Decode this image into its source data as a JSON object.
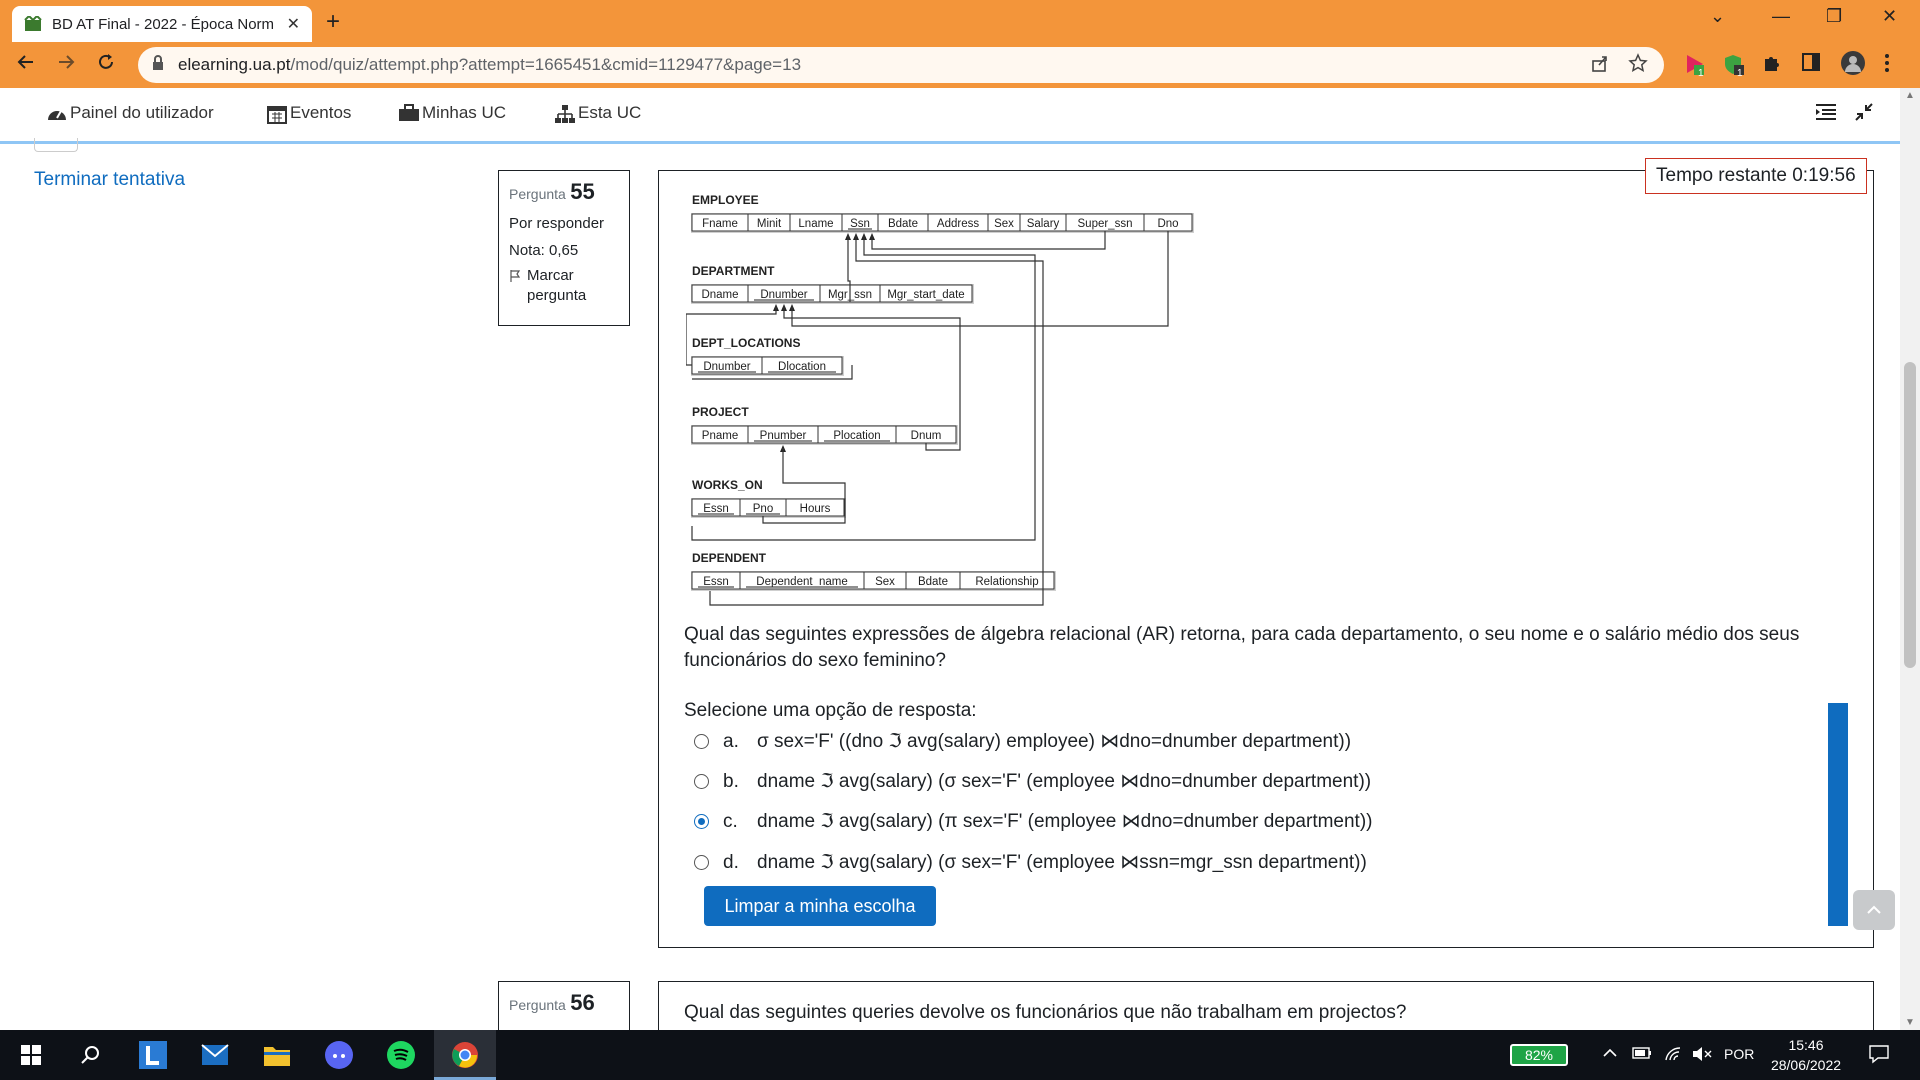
{
  "browser": {
    "tab_title": "BD AT Final - 2022 - Época Norm",
    "tab_close": "✕",
    "new_tab": "+",
    "url_host": "elearning.ua.pt",
    "url_path": "/mod/quiz/attempt.php?attempt=1665451&cmid=1129477&page=13",
    "window_controls": [
      "⌄",
      "—",
      "❐",
      "✕"
    ],
    "extension_badges": [
      "1",
      "1"
    ]
  },
  "site_nav": {
    "items": [
      {
        "label": "Painel do utilizador",
        "icon": "dashboard-icon"
      },
      {
        "label": "Eventos",
        "icon": "calendar-icon"
      },
      {
        "label": "Minhas UC",
        "icon": "briefcase-icon"
      },
      {
        "label": "Esta UC",
        "icon": "sitemap-icon"
      }
    ]
  },
  "sidebar": {
    "finish_attempt": "Terminar tentativa"
  },
  "question55": {
    "label": "Pergunta",
    "number": "55",
    "status": "Por responder",
    "grade": "Nota: 0,65",
    "flag": "Marcar pergunta",
    "timer": "Tempo restante 0:19:56",
    "text": "Qual das seguintes expressões de álgebra relacional (AR) retorna, para cada departamento, o seu nome e o salário médio dos seus funcionários do sexo feminino?",
    "prompt": "Selecione uma opção de resposta:",
    "options": [
      {
        "letter": "a.",
        "text": "σ sex='F' ((dno ℑ avg(salary) employee) ⋈dno=dnumber department))",
        "checked": false
      },
      {
        "letter": "b.",
        "text": "dname ℑ avg(salary) (σ sex='F' (employee ⋈dno=dnumber department))",
        "checked": false
      },
      {
        "letter": "c.",
        "text": "dname ℑ avg(salary) (π sex='F' (employee ⋈dno=dnumber department))",
        "checked": true
      },
      {
        "letter": "d.",
        "text": "dname ℑ avg(salary) (σ sex='F' (employee ⋈ssn=mgr_ssn department))",
        "checked": false
      }
    ],
    "clear_button": "Limpar a minha escolha"
  },
  "schema": {
    "employee": {
      "title": "EMPLOYEE",
      "cols": [
        "Fname",
        "Minit",
        "Lname",
        "Ssn",
        "Bdate",
        "Address",
        "Sex",
        "Salary",
        "Super_ssn",
        "Dno"
      ]
    },
    "department": {
      "title": "DEPARTMENT",
      "cols": [
        "Dname",
        "Dnumber",
        "Mgr_ssn",
        "Mgr_start_date"
      ]
    },
    "dept_locations": {
      "title": "DEPT_LOCATIONS",
      "cols": [
        "Dnumber",
        "Dlocation"
      ]
    },
    "project": {
      "title": "PROJECT",
      "cols": [
        "Pname",
        "Pnumber",
        "Plocation",
        "Dnum"
      ]
    },
    "works_on": {
      "title": "WORKS_ON",
      "cols": [
        "Essn",
        "Pno",
        "Hours"
      ]
    },
    "dependent": {
      "title": "DEPENDENT",
      "cols": [
        "Essn",
        "Dependent_name",
        "Sex",
        "Bdate",
        "Relationship"
      ]
    }
  },
  "question56": {
    "label": "Pergunta",
    "number": "56",
    "text": "Qual das seguintes queries devolve os funcionários que não trabalham em projectos?"
  },
  "taskbar": {
    "battery": "82%",
    "language": "POR",
    "time": "15:46",
    "date": "28/06/2022"
  },
  "colors": {
    "chrome_accent": "#f3953a",
    "link": "#0f6cbf",
    "timer_border": "#ca3120",
    "taskbar": "#0d1117"
  }
}
